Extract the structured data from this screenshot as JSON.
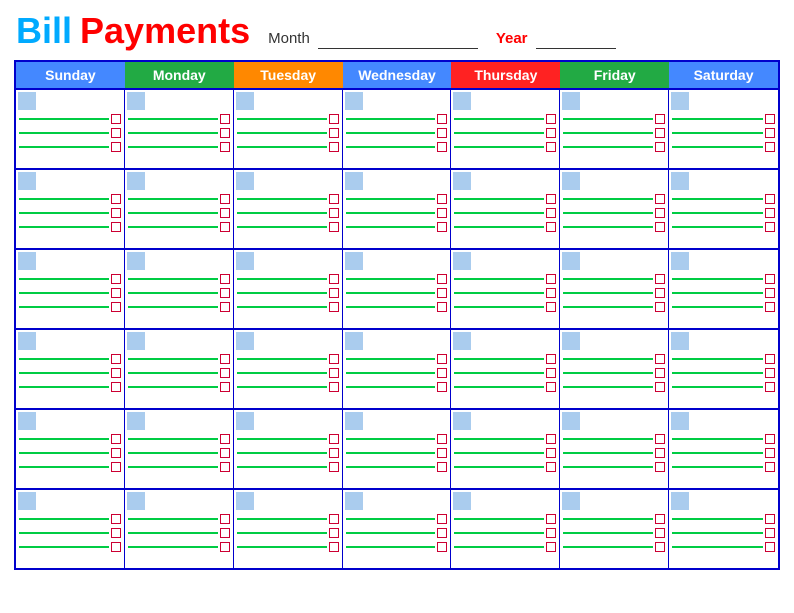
{
  "header": {
    "title_bill": "Bill",
    "title_payments": "Payments",
    "month_label": "Month",
    "year_label": "Year"
  },
  "days": [
    "Sunday",
    "Monday",
    "Tuesday",
    "Wednesday",
    "Thursday",
    "Friday",
    "Saturday"
  ],
  "day_classes": [
    "sunday",
    "monday",
    "tuesday",
    "wednesday",
    "thursday",
    "friday",
    "saturday"
  ],
  "weeks": 6,
  "lines_per_cell": 3
}
